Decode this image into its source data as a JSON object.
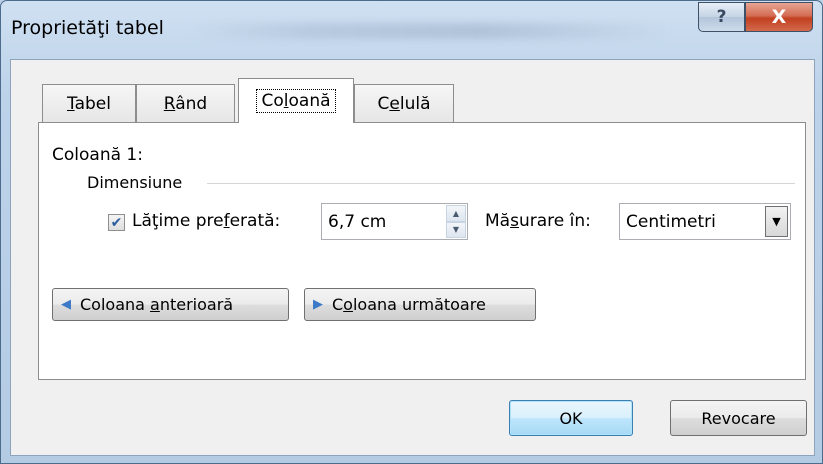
{
  "window": {
    "title": "Proprietăţi tabel",
    "help_glyph": "?",
    "close_glyph": "X"
  },
  "tabs": [
    {
      "label": "Tabel",
      "mnemonic_index": 0,
      "active": false
    },
    {
      "label": "Rând",
      "mnemonic_index": 0,
      "active": false
    },
    {
      "label": "Coloană",
      "mnemonic_index": 2,
      "active": true
    },
    {
      "label": "Celulă",
      "mnemonic_index": 1,
      "active": false
    }
  ],
  "column_page": {
    "column_label": "Coloană 1:",
    "group_label": "Dimensiune",
    "preferred_width": {
      "checked": true,
      "label_pre": "Lăţime pre",
      "label_mnemonic": "f",
      "label_post": "erată:",
      "value": "6,7 cm"
    },
    "measure_in": {
      "label_pre": "Mă",
      "label_mnemonic": "s",
      "label_post": "urare în:",
      "value": "Centimetri"
    },
    "prev_button": {
      "label_pre": "Coloana ",
      "label_mnemonic": "a",
      "label_post": "nterioară",
      "icon": "arrow-left-icon"
    },
    "next_button": {
      "label_pre": "C",
      "label_mnemonic": "o",
      "label_post": "loana următoare",
      "icon": "arrow-right-icon"
    }
  },
  "footer": {
    "ok_label": "OK",
    "cancel_label": "Revocare"
  },
  "colors": {
    "accent_arrow": "#3c79c6",
    "close_button": "#c2401f",
    "default_button_border": "#3c7fb1"
  }
}
